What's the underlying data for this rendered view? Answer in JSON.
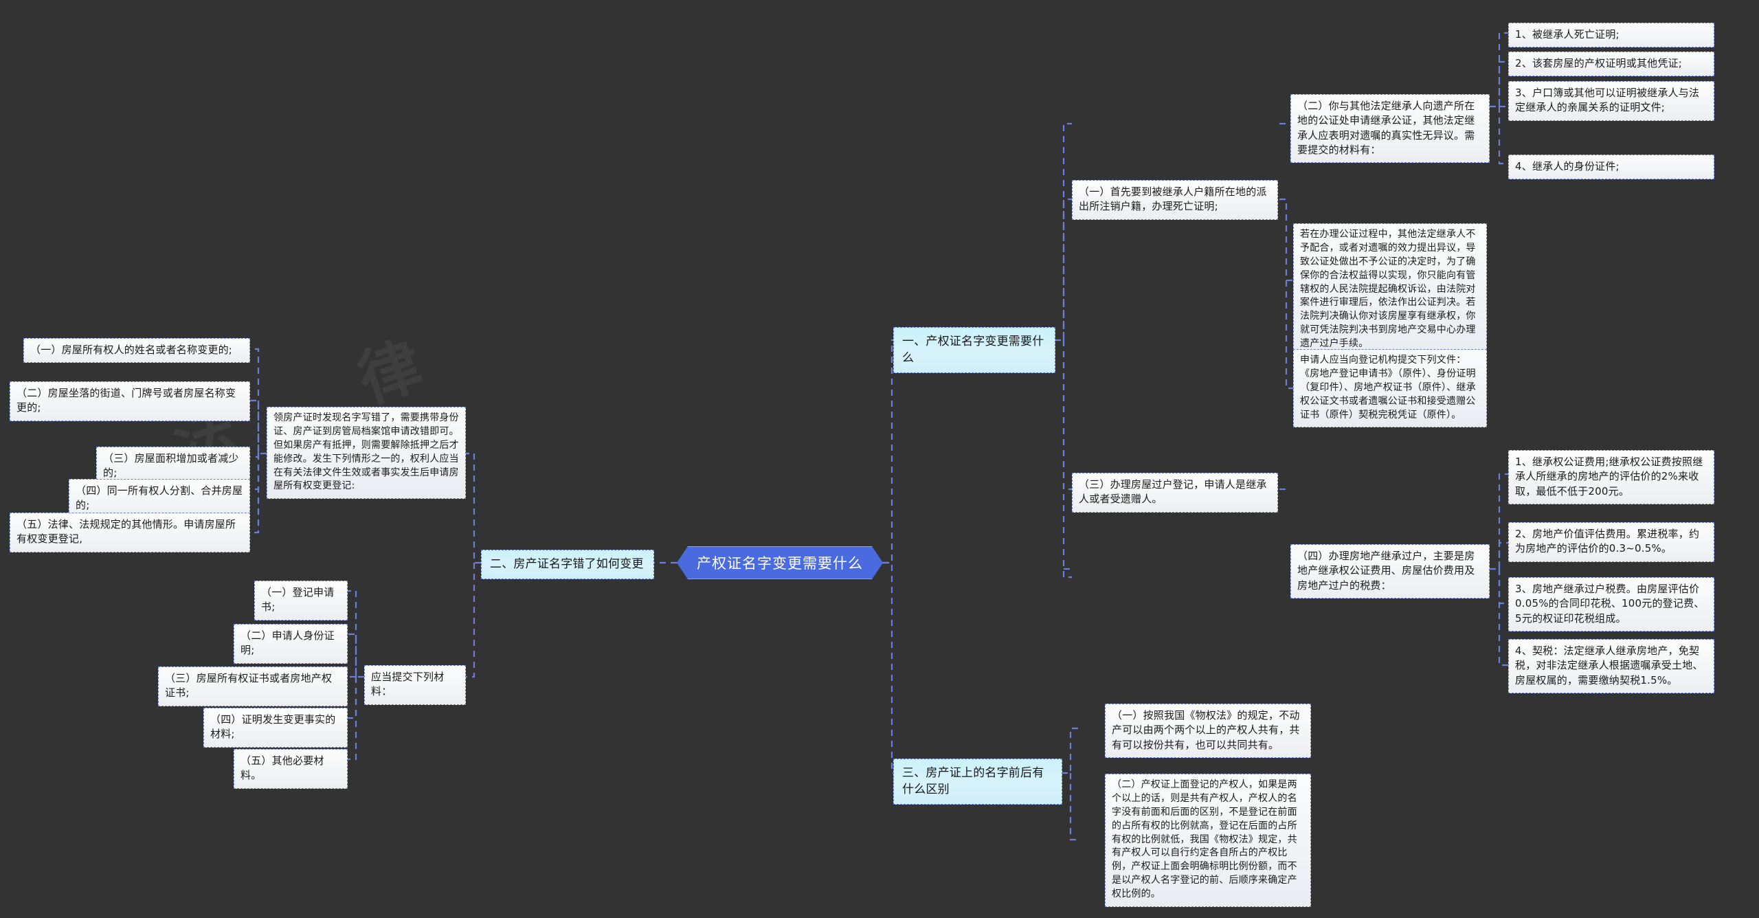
{
  "meta": {
    "background_color": "#333333",
    "link_color": "#6b7fd7",
    "center_color": "#4a6be0",
    "branch_color": "#cdf1fa",
    "leaf_color": "#f2f4f7"
  },
  "center": {
    "label": "产权证名字变更需要什么"
  },
  "watermarks": [
    "法",
    "律",
    "咨"
  ],
  "branches": [
    {
      "id": "branch-1",
      "label": "一、产权证名字变更需要什么"
    },
    {
      "id": "branch-2",
      "label": "二、房产证名字错了如何变更"
    },
    {
      "id": "branch-3",
      "label": "三、房产证上的名字前后有什么区别"
    }
  ],
  "branch1": {
    "items": [
      {
        "id": "b1-i1",
        "text": "（一）首先要到被继承人户籍所在地的派出所注销户籍，办理死亡证明;"
      },
      {
        "id": "b1-i2",
        "text": "（二）你与其他法定继承人向遗产所在地的公证处申请继承公证，其他法定继承人应表明对遗嘱的真实性无异议。需要提交的材料有："
      },
      {
        "id": "b1-i2-note",
        "text": "若在办理公证过程中，其他法定继承人不予配合，或者对遗嘱的效力提出异议，导致公证处做出不予公证的决定时，为了确保你的合法权益得以实现，你只能向有管辖权的人民法院提起确权诉讼，由法院对案件进行审理后，依法作出公证判决。若法院判决确认你对该房屋享有继承权，你就可凭法院判决书到房地产交易中心办理遗产过户手续。"
      },
      {
        "id": "b1-i2-note2",
        "text": "申请人应当向登记机构提交下列文件：《房地产登记申请书》（原件）、身份证明（复印件）、房地产权证书（原件）、继承权公证文书或者遗嘱公证书和接受遗赠公证书（原件）契税完税凭证（原件）。"
      },
      {
        "id": "b1-i3",
        "text": "（三）办理房屋过户登记，申请人是继承人或者受遗赠人。"
      },
      {
        "id": "b1-i4",
        "text": "（四）办理房地产继承过户，主要是房地产继承权公证费用、房屋估价费用及房地产过户的税费："
      }
    ],
    "materials": [
      {
        "id": "b1-m1",
        "text": "1、被继承人死亡证明;"
      },
      {
        "id": "b1-m2",
        "text": "2、该套房屋的产权证明或其他凭证;"
      },
      {
        "id": "b1-m3",
        "text": "3、户口簿或其他可以证明被继承人与法定继承人的亲属关系的证明文件;"
      },
      {
        "id": "b1-m4",
        "text": "4、继承人的身份证件;"
      }
    ],
    "fees": [
      {
        "id": "b1-f1",
        "text": "1、继承权公证费用;继承权公证费按照继承人所继承的房地产的评估价的2%来收取，最低不低于200元。"
      },
      {
        "id": "b1-f2",
        "text": "2、房地产价值评估费用。累进税率，约为房地产的评估价的0.3~0.5%。"
      },
      {
        "id": "b1-f3",
        "text": "3、房地产继承过户税费。由房屋评估价0.05%的合同印花税、100元的登记费、5元的权证印花税组成。"
      },
      {
        "id": "b1-f4",
        "text": "4、契税：法定继承人继承房地产，免契税，对非法定继承人根据遗嘱承受土地、房屋权属的，需要缴纳契税1.5%。"
      }
    ]
  },
  "branch2": {
    "summary": "领房产证时发现名字写错了，需要携带身份证、房产证到房管局档案馆申请改错即可。但如果房产有抵押，则需要解除抵押之后才能修改。发生下列情形之一的，权利人应当在有关法律文件生效或者事实发生后申请房屋所有权变更登记:",
    "cases": [
      {
        "id": "b2-c1",
        "text": "（一）房屋所有权人的姓名或者名称变更的;"
      },
      {
        "id": "b2-c2",
        "text": "（二）房屋坐落的街道、门牌号或者房屋名称变更的;"
      },
      {
        "id": "b2-c3",
        "text": "（三）房屋面积增加或者减少的;"
      },
      {
        "id": "b2-c4",
        "text": "（四）同一所有权人分割、合并房屋的;"
      },
      {
        "id": "b2-c5",
        "text": "（五）法律、法规规定的其他情形。申请房屋所有权变更登记,"
      }
    ],
    "materials_title": "应当提交下列材料：",
    "materials": [
      {
        "id": "b2-m1",
        "text": "（一）登记申请书;"
      },
      {
        "id": "b2-m2",
        "text": "（二）申请人身份证明;"
      },
      {
        "id": "b2-m3",
        "text": "（三）房屋所有权证书或者房地产权证书;"
      },
      {
        "id": "b2-m4",
        "text": "（四）证明发生变更事实的材料;"
      },
      {
        "id": "b2-m5",
        "text": "（五）其他必要材料。"
      }
    ]
  },
  "branch3": {
    "items": [
      {
        "id": "b3-i1",
        "text": "（一）按照我国《物权法》的规定，不动产可以由两个两个以上的产权人共有，共有可以按份共有，也可以共同共有。"
      },
      {
        "id": "b3-i2",
        "text": "（二）产权证上面登记的产权人，如果是两个以上的话，则是共有产权人，产权人的名字没有前面和后面的区别，不是登记在前面的占所有权的比例就高，登记在后面的占所有权的比例就低，我国《物权法》规定，共有产权人可以自行约定各自所占的产权比例，产权证上面会明确标明比例份额，而不是以产权人名字登记的前、后顺序来确定产权比例的。"
      }
    ]
  }
}
